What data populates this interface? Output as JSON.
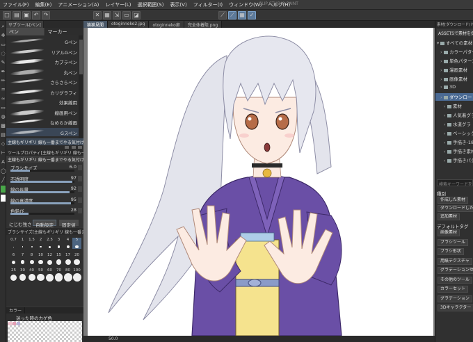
{
  "menubar": {
    "items": [
      "ファイル(F)",
      "編集(E)",
      "アニメーション(A)",
      "レイヤー(L)",
      "選択範囲(S)",
      "表示(V)",
      "フィルター(I)",
      "ウィンドウ(W)",
      "ヘルプ(H)"
    ],
    "title": "CLIP STUDIO PAINT"
  },
  "left_panel": {
    "tab": "サブツール[ペン]",
    "subtabs": [
      "ペン",
      "マーカー"
    ],
    "brushes": [
      "Gペン",
      "リアルGペン",
      "カブラペン",
      "丸ペン",
      "さらさらペン",
      "カリグラフィ",
      "効果線用",
      "線画用ペン",
      "なめらか線画",
      "Gスペン"
    ],
    "info_bar": "主線もギリギリ 線も一番までやる気付けもGペン",
    "tool_property_title": "ツールプロパティ[主線もギリギリ 線も一番までやる気付けもGペン]",
    "tool_property_header": "主線もギリギリ 線も一番までやる気付けもGペン",
    "properties": [
      {
        "label": "ブラシサイズ",
        "value": "6.0",
        "fill": 0.3
      },
      {
        "label": "不透明度",
        "value": "97",
        "fill": 0.97
      },
      {
        "label": "線の長量",
        "value": "92",
        "fill": 0.92
      },
      {
        "label": "線の真濃度",
        "value": "95",
        "fill": 0.95
      },
      {
        "label": "色鉛び",
        "value": "28",
        "fill": 0.28
      }
    ],
    "blend_label": "にじむ強さ",
    "blend_buttons": [
      "自動設定",
      "固定値"
    ],
    "brush_size_title": "ブラシサイズ[主線もギリギリ 線も一番までやる気付けもGペン]",
    "sizes": [
      "0.7",
      "1",
      "1.5",
      "2",
      "2.5",
      "3",
      "4",
      "5",
      "6",
      "7",
      "8",
      "10",
      "12",
      "15",
      "17",
      "20",
      "25",
      "30",
      "40",
      "50",
      "60",
      "70",
      "80",
      "100"
    ],
    "selected_size": "5",
    "color_tabs": [
      "カラー",
      ""
    ],
    "color_label": "迷った時のカゲ色"
  },
  "canvas": {
    "tabs": [
      "猫猫見聞",
      "otoginneko2.jpg",
      "otoginneko扉",
      "完全体着陸.png"
    ],
    "zoom": "50.0"
  },
  "right_panel": {
    "title": "素材[ダウンロード/ドキ...]",
    "assets_button": "ASSETSで素材を探す",
    "tree": [
      {
        "label": "すべての素材",
        "indent": 0,
        "selected": false
      },
      {
        "label": "カラーパターン",
        "indent": 1,
        "selected": false
      },
      {
        "label": "単色パターン",
        "indent": 1,
        "selected": false
      },
      {
        "label": "漫画素材",
        "indent": 1,
        "selected": false
      },
      {
        "label": "画像素材",
        "indent": 1,
        "selected": false
      },
      {
        "label": "3D",
        "indent": 1,
        "selected": false
      },
      {
        "label": "ダウンロード",
        "indent": 1,
        "selected": true
      },
      {
        "label": "素材",
        "indent": 2,
        "selected": false
      },
      {
        "label": "人気着グラ",
        "indent": 2,
        "selected": false
      },
      {
        "label": "水道グラ",
        "indent": 2,
        "selected": false
      },
      {
        "label": "ベーシック",
        "indent": 2,
        "selected": false
      },
      {
        "label": "手描き-185",
        "indent": 2,
        "selected": false
      },
      {
        "label": "手描き素材",
        "indent": 2,
        "selected": false
      },
      {
        "label": "手描きパタ",
        "indent": 2,
        "selected": false
      }
    ],
    "search_placeholder": "検索キーワードを",
    "kind_title": "種別",
    "kind_buttons": [
      "作成した素材",
      "ダウンロードした素材",
      "追加素材"
    ],
    "tag_title": "デフォルトタグ",
    "tag_buttons": [
      "画像素材",
      "ブラシツール",
      "ブラシ形状",
      "用紙テクスチャ",
      "グラデーションセット",
      "その他のツール",
      "カラーセット",
      "グラデーション",
      "3Dキャラクター"
    ]
  },
  "colors": {
    "accent": "#4a6a94",
    "hair": "#dfe1ea",
    "kimono": "#6a4aa8",
    "obi": "#f4e08a",
    "skin": "#fbe9df",
    "eye": "#b06a48"
  }
}
